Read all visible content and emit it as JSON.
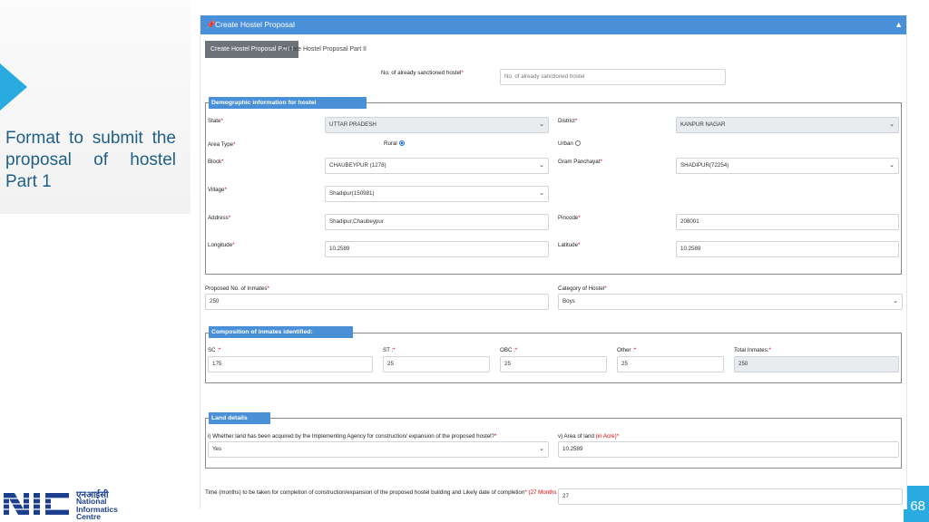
{
  "slide": {
    "caption": "Format to submit the proposal of hostel Part 1",
    "page_number": "68",
    "logo_hindi": "एनआईसी",
    "logo_line1": "National",
    "logo_line2": "Informatics",
    "logo_line3": "Centre",
    "accent_color": "#29abe2"
  },
  "window": {
    "title": "Create Hostel Proposal",
    "collapse_icon": "chevron-up-icon",
    "tabs": [
      {
        "label": "Create Hostel Proposal Part I",
        "active": true
      },
      {
        "label": "Create Hostel Proposal Part II",
        "active": false
      }
    ]
  },
  "form": {
    "sanctioned": {
      "label": "No. of already sanctioned hostel",
      "placeholder": "No. of already sanctioned hostel"
    },
    "demographic": {
      "legend": "Demographic information for hostel",
      "state": {
        "label": "State",
        "value": "UTTAR PRADESH"
      },
      "district": {
        "label": "District",
        "value": "KANPUR NAGAR"
      },
      "area_type": {
        "label": "Area Type",
        "rural": "Rural",
        "urban": "Urban",
        "selected": "Rural"
      },
      "block": {
        "label": "Block",
        "value": "CHAUBEYPUR (1278)"
      },
      "gram": {
        "label": "Gram Panchayat",
        "value": "SHADIPUR(72254)"
      },
      "village": {
        "label": "Village",
        "value": "Shadipur(150981)"
      },
      "address": {
        "label": "Address",
        "value": "Shadipur,Chaubeypur"
      },
      "pincode": {
        "label": "Pincode",
        "value": "208001"
      },
      "longitude": {
        "label": "Longitude",
        "value": "10.2589"
      },
      "latitude": {
        "label": "Latitude",
        "value": "10.2589"
      }
    },
    "inmates": {
      "label": "Proposed No. of Inmates",
      "value": "250"
    },
    "category": {
      "label": "Category of Hostel",
      "value": "Boys"
    },
    "composition": {
      "legend": "Composition of inmates identified:",
      "sc": {
        "label": "SC :",
        "value": "175"
      },
      "st": {
        "label": "ST :",
        "value": "25"
      },
      "obc": {
        "label": "OBC :",
        "value": "25"
      },
      "other": {
        "label": "Other :",
        "value": "25"
      },
      "total": {
        "label": "Total Inmates:",
        "value": "250"
      }
    },
    "land": {
      "legend": "Land details",
      "acquired": {
        "label": "i) Whether land has been acquired by the Implementing Agency for construction/ expansion of the proposed hostel?",
        "value": "Yes"
      },
      "area": {
        "label": "v) Area of land",
        "unit": "(in Acre)",
        "value": "10.2589"
      }
    },
    "time": {
      "label": "Time (months) to be taken for completion of construction/expansion of the proposed hostel building and Likely date of completion",
      "max": "(27 Months max)",
      "value": "27"
    }
  }
}
